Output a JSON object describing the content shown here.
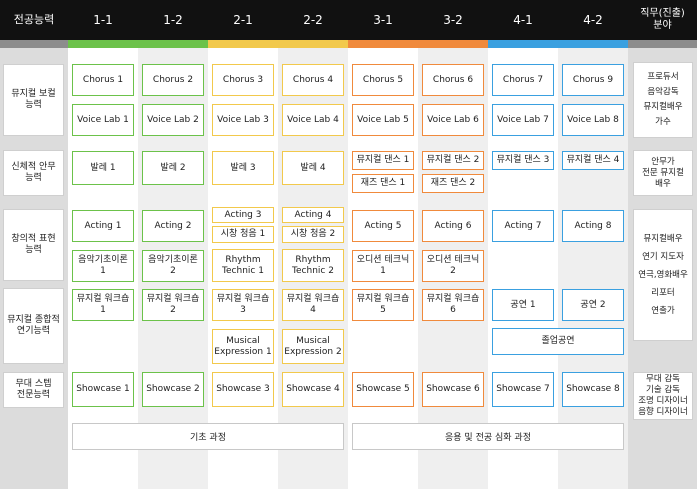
{
  "header": {
    "competency": "전공능력",
    "semesters": [
      "1-1",
      "1-2",
      "2-1",
      "2-2",
      "3-1",
      "3-2",
      "4-1",
      "4-2"
    ],
    "job_line1": "직무(진출)",
    "job_line2": "분야"
  },
  "colors": {
    "stripe_year1": "#6cc24a",
    "stripe_year2": "#f2c94c",
    "stripe_year3": "#f08a3c",
    "stripe_year4": "#3aa0e0",
    "stripe_side": "#8c8c8c",
    "header_bg": "#111111"
  },
  "rows": {
    "vocal": "뮤지컬 보컬\n능력",
    "dance": "신체적 안무\n능력",
    "acting": "창의적 표현\n능력",
    "integrated": "뮤지컬 종합적\n연기능력",
    "stage": "무대 스텝\n전문능력"
  },
  "cells": {
    "vocal": {
      "chorus": [
        "Chorus 1",
        "Chorus 2",
        "Chorus 3",
        "Chorus 4",
        "Chorus 5",
        "Chorus 6",
        "Chorus 7",
        "Chorus 9"
      ],
      "voicelab": [
        "Voice Lab 1",
        "Voice Lab 2",
        "Voice Lab 3",
        "Voice Lab 4",
        "Voice Lab 5",
        "Voice Lab 6",
        "Voice Lab 7",
        "Voice Lab 8"
      ]
    },
    "dance": {
      "ballet": [
        "발레 1",
        "발레 2",
        "발레 3",
        "발레 4"
      ],
      "musical_dance": [
        "뮤지컬 댄스 1",
        "뮤지컬 댄스 2",
        "뮤지컬 댄스 3",
        "뮤지컬 댄스 4"
      ],
      "jazz": [
        "재즈 댄스 1",
        "재즈 댄스 2"
      ]
    },
    "acting": {
      "acting": [
        "Acting 1",
        "Acting 2",
        "Acting 3",
        "Acting 4",
        "Acting 5",
        "Acting 6",
        "Acting 7",
        "Acting 8"
      ],
      "sight_singing": [
        "시창 청음 1",
        "시창 청음 2"
      ],
      "music_theory": [
        "음악기초이론 1",
        "음악기초이론 2"
      ],
      "rhythm": [
        "Rhythm\nTechnic 1",
        "Rhythm\nTechnic 2"
      ],
      "audition": [
        "오디션 테크닉 1",
        "오디션 테크닉 2"
      ]
    },
    "integrated": {
      "workshop": [
        "뮤지컬 워크숍 1",
        "뮤지컬 워크숍 2",
        "뮤지컬 워크숍 3",
        "뮤지컬 워크숍 4",
        "뮤지컬 워크숍 5",
        "뮤지컬 워크숍 6"
      ],
      "performance": [
        "공연 1",
        "공연 2"
      ],
      "expression": [
        "Musical\nExpression 1",
        "Musical\nExpression 2"
      ],
      "graduation": "졸업공연"
    },
    "stage": {
      "showcase": [
        "Showcase 1",
        "Showcase 2",
        "Showcase 3",
        "Showcase 4",
        "Showcase 5",
        "Showcase 6",
        "Showcase 7",
        "Showcase 8"
      ]
    }
  },
  "jobs": {
    "vocal": [
      "프로듀서",
      "음악감독",
      "뮤지컬배우",
      "가수"
    ],
    "dance": [
      "안무가",
      "전문 뮤지컬",
      "배우"
    ],
    "acting": [
      "뮤지컬배우",
      "연기 지도자",
      "연극,영화배우",
      "리포터",
      "연출가"
    ],
    "stage": [
      "무대 감독",
      "기술 감독",
      "조명 디자이너",
      "음향 디자이너"
    ]
  },
  "courses": {
    "basic": "기초 과정",
    "advanced": "응용 및 전공 심화 과정"
  }
}
